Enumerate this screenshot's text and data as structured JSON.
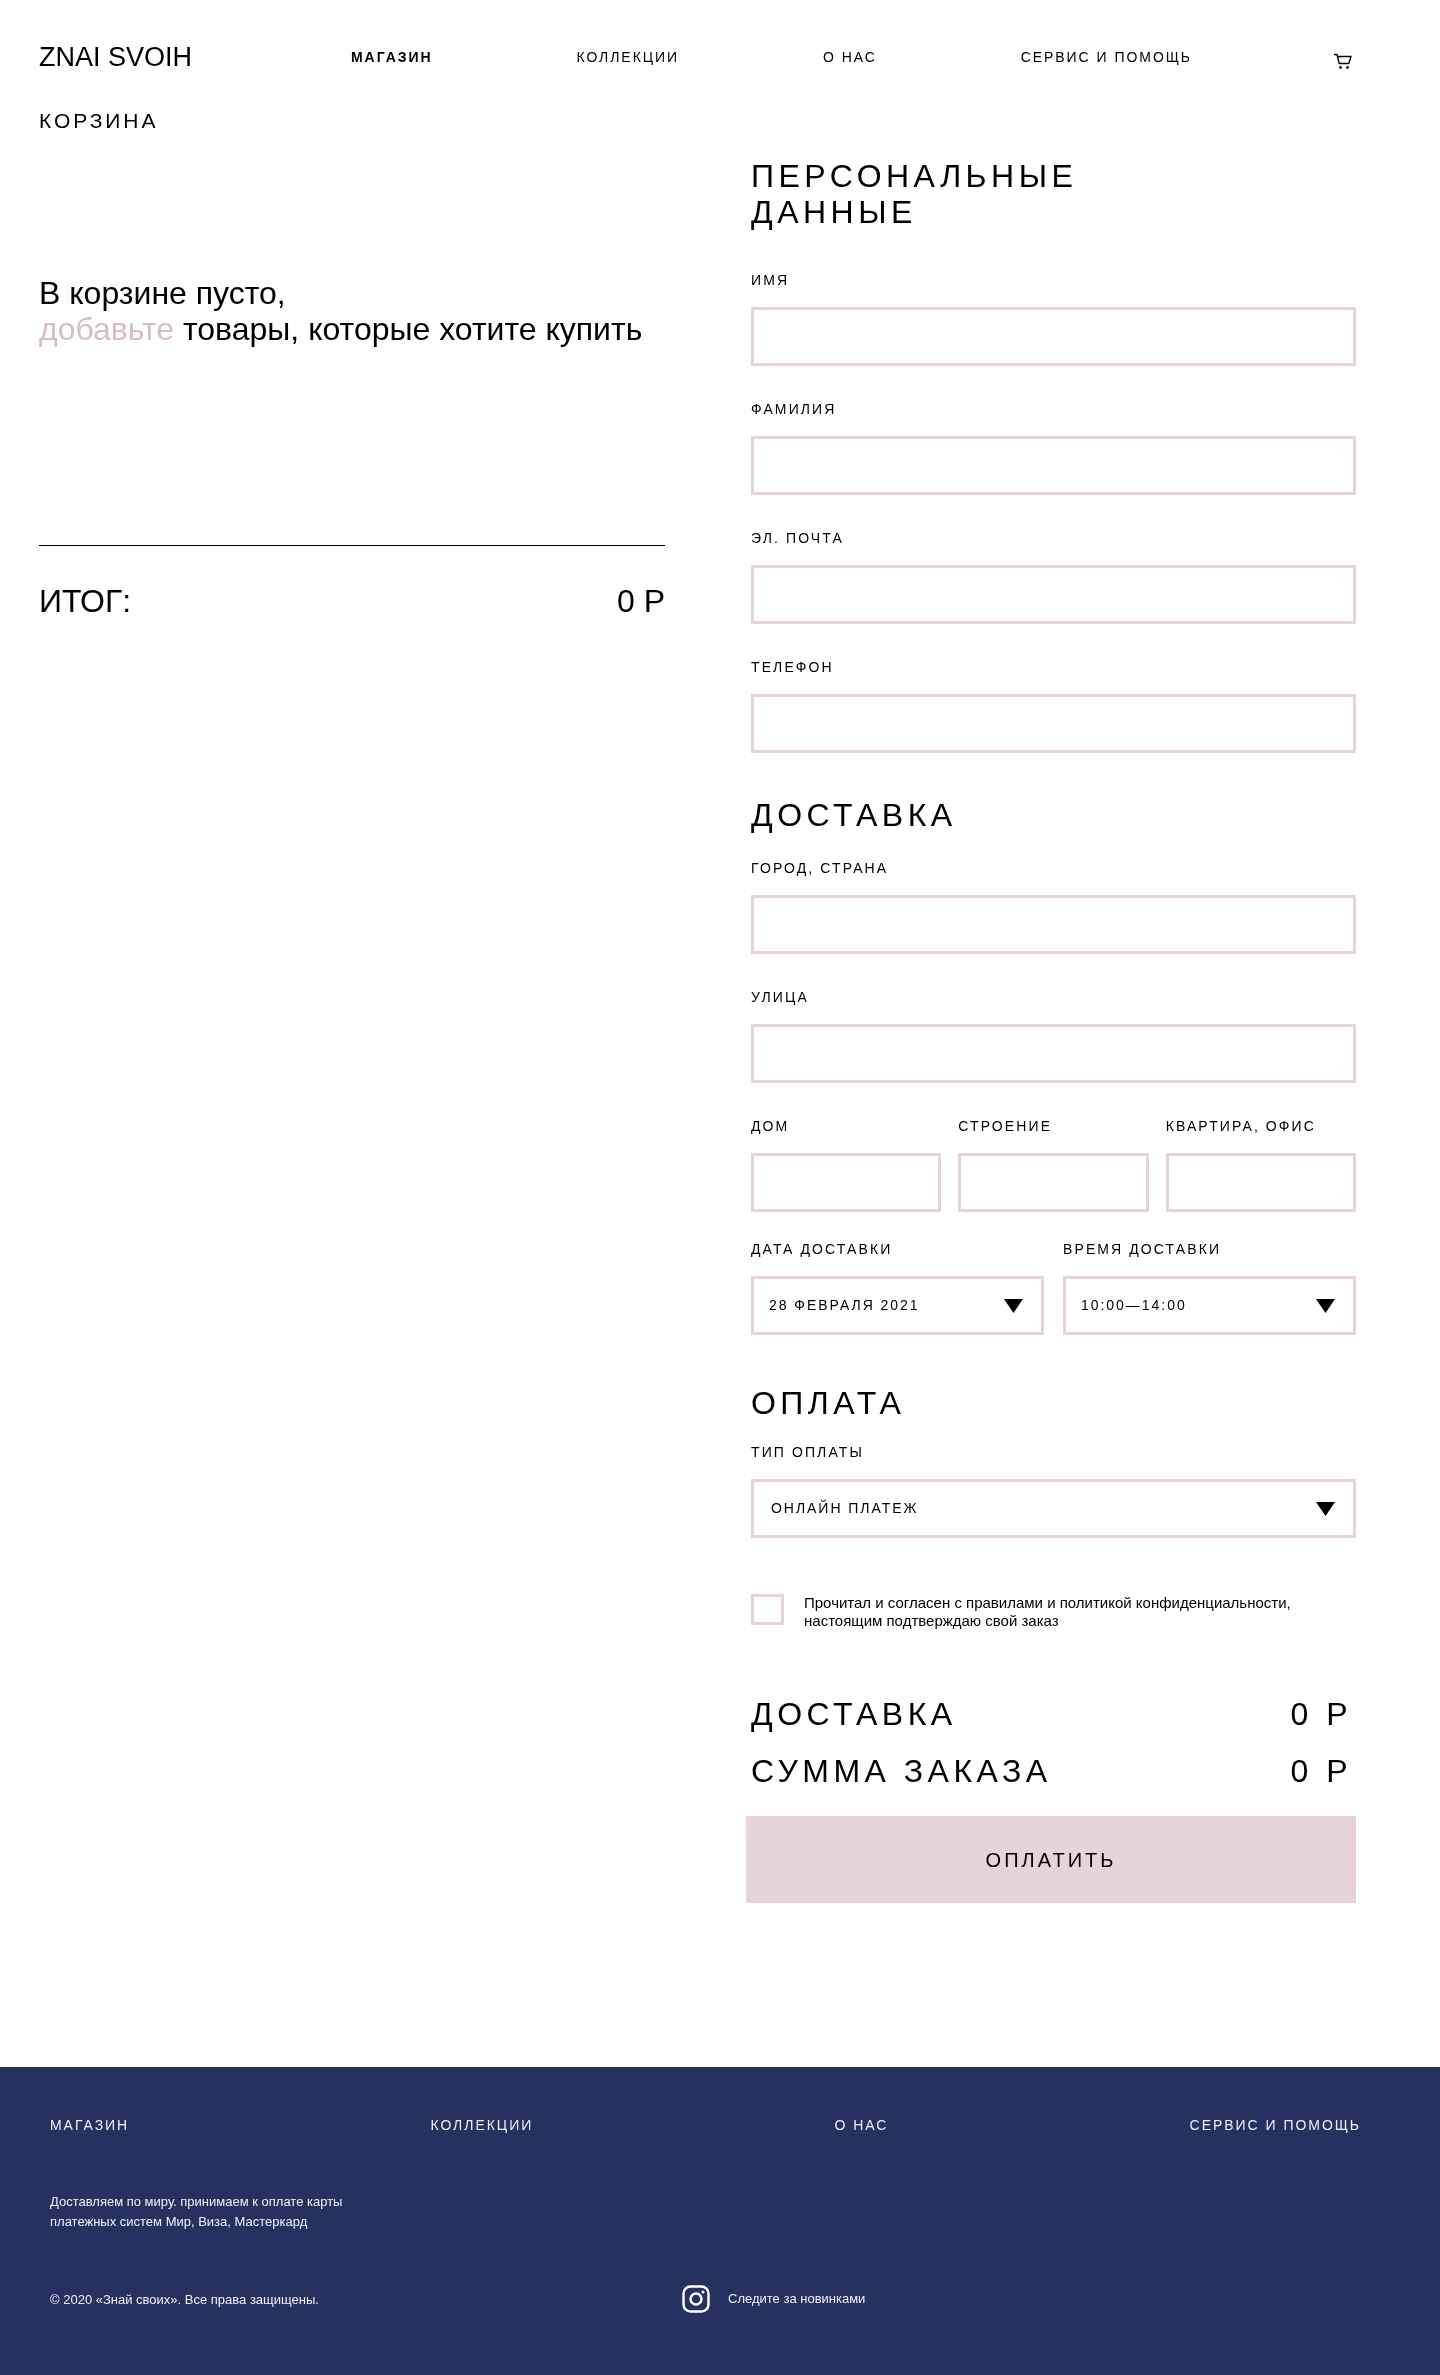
{
  "header": {
    "logo": "ZNAI SVOIH",
    "nav": [
      {
        "label": "МАГАЗИН",
        "selected": true
      },
      {
        "label": "КОЛЛЕКЦИИ",
        "selected": false
      },
      {
        "label": "О НАС",
        "selected": false
      },
      {
        "label": "СЕРВИС И ПОМОЩЬ",
        "selected": false
      }
    ]
  },
  "cart": {
    "title": "КОРЗИНА",
    "empty_message": {
      "line_1": "В корзине пусто,",
      "link": "добавьте",
      "line_2_rest": "товары, которые хотите купить"
    },
    "total": {
      "label": "ИТОГ:",
      "value": "0 Р"
    }
  },
  "personal": {
    "title": "ПЕРСОНАЛЬНЫЕ ДАННЫЕ",
    "fields": [
      {
        "label": "ИМЯ"
      },
      {
        "label": "ФАМИЛИЯ"
      },
      {
        "label": "ЭЛ. ПОЧТА"
      },
      {
        "label": "ТЕЛЕФОН"
      }
    ]
  },
  "delivery": {
    "title": "ДОСТАВКА",
    "fields": [
      {
        "label": "ГОРОД, СТРАНА"
      },
      {
        "label": "УЛИЦА"
      }
    ],
    "address_row": [
      {
        "label": "ДОМ"
      },
      {
        "label": "СТРОЕНИЕ"
      },
      {
        "label": "КВАРТИРА, ОФИС"
      }
    ],
    "schedule": [
      {
        "label": "ДАТА ДОСТАВКИ",
        "value": "28 ФЕВРАЛЯ 2021"
      },
      {
        "label": "ВРЕМЯ ДОСТАВКИ",
        "value": "10:00—14:00"
      }
    ]
  },
  "payment": {
    "title": "ОПЛАТА",
    "type": {
      "label": "ТИП ОПЛАТЫ",
      "value": "ОНЛАЙН ПЛАТЕЖ"
    },
    "agreement": {
      "checked": false,
      "lines": [
        "Прочитал и согласен с правилами и политикой конфиденциальности,",
        "настоящим подтверждаю свой заказ"
      ]
    }
  },
  "summary": [
    {
      "label": "ДОСТАВКА",
      "value": "0 Р"
    },
    {
      "label": "СУММА ЗАКАЗА",
      "value": "0 Р"
    }
  ],
  "pay_button": "ОПЛАТИТЬ",
  "footer": {
    "nav": [
      "МАГАЗИН",
      "КОЛЛЕКЦИИ",
      "О НАС",
      "СЕРВИС И ПОМОЩЬ"
    ],
    "info_lines": [
      "Доставляем по миру. принимаем к оплате карты",
      "платежных систем Мир, Виза, Мастеркард"
    ],
    "copyright": "© 2020 «Знай своих». Все права защищены.",
    "follow": "Следите за новинками"
  }
}
